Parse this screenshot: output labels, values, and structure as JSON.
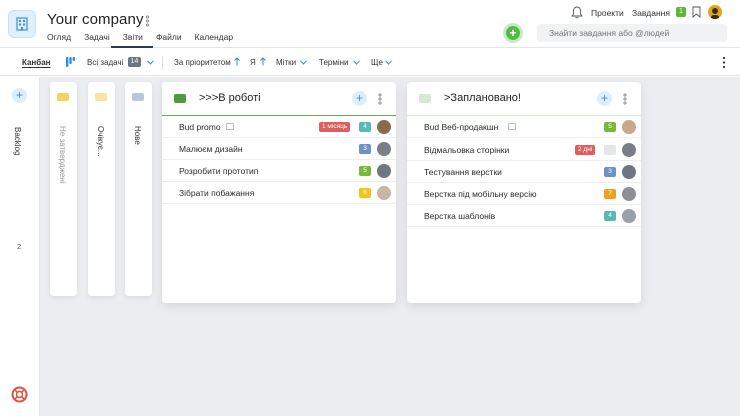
{
  "header": {
    "company": "Your company",
    "tabs": [
      {
        "label": "Огляд"
      },
      {
        "label": "Задачі"
      },
      {
        "label": "Звіти"
      },
      {
        "label": "Файли"
      },
      {
        "label": "Календар"
      }
    ],
    "search_placeholder": "Знайти завдання або @людей",
    "projects_link": "Проекти",
    "tasks_link": "Завдання",
    "tasks_count": "1"
  },
  "toolbar": {
    "kanban": "Канбан",
    "all_tasks": "Всі задачі",
    "all_tasks_count": "14",
    "priority": "За пріоритетом",
    "me": "Я",
    "labels": "Мітки",
    "deadlines": "Терміни",
    "more": "Ще"
  },
  "rail": {
    "backlog": "Backlog",
    "backlog_count": "2"
  },
  "collapsed_columns": [
    {
      "label": "Не затверджені",
      "color": "#f4d35e"
    },
    {
      "label": "Очікує...",
      "color": "#f6e4a3"
    },
    {
      "label": "Нове",
      "color": "#b9c6de"
    }
  ],
  "columns": [
    {
      "title": ">>>В роботі",
      "color": "#4f9a3f",
      "tasks": [
        {
          "name": "Bud promo",
          "tag": "1 місяць",
          "tag_color": "#e05d5d",
          "num": "4",
          "num_color": "#5bb8b4"
        },
        {
          "name": "Малюєм дизайн",
          "num": "3",
          "num_color": "#6a93c6"
        },
        {
          "name": "Розробити прототип",
          "num": "5",
          "num_color": "#79b83a"
        },
        {
          "name": "Зібрати побажання",
          "num": "6",
          "num_color": "#f0c419"
        }
      ]
    },
    {
      "title": ">Заплановано!",
      "color": "#d6ead2",
      "tasks": [
        {
          "name": "Bud Веб-продакшн",
          "num": "5",
          "num_color": "#79b83a"
        },
        {
          "name": "Відмальовка сторінки",
          "tag": "2 дні",
          "tag_color": "#e05d5d",
          "num": "",
          "num_color": "#e4e6e8"
        },
        {
          "name": "Тестування верстки",
          "num": "3",
          "num_color": "#6a93c6"
        },
        {
          "name": "Верстка під мобільну версію",
          "num": "7",
          "num_color": "#f0a020"
        },
        {
          "name": "Верстка шаблонів",
          "num": "4",
          "num_color": "#5bb8b4"
        }
      ]
    }
  ]
}
